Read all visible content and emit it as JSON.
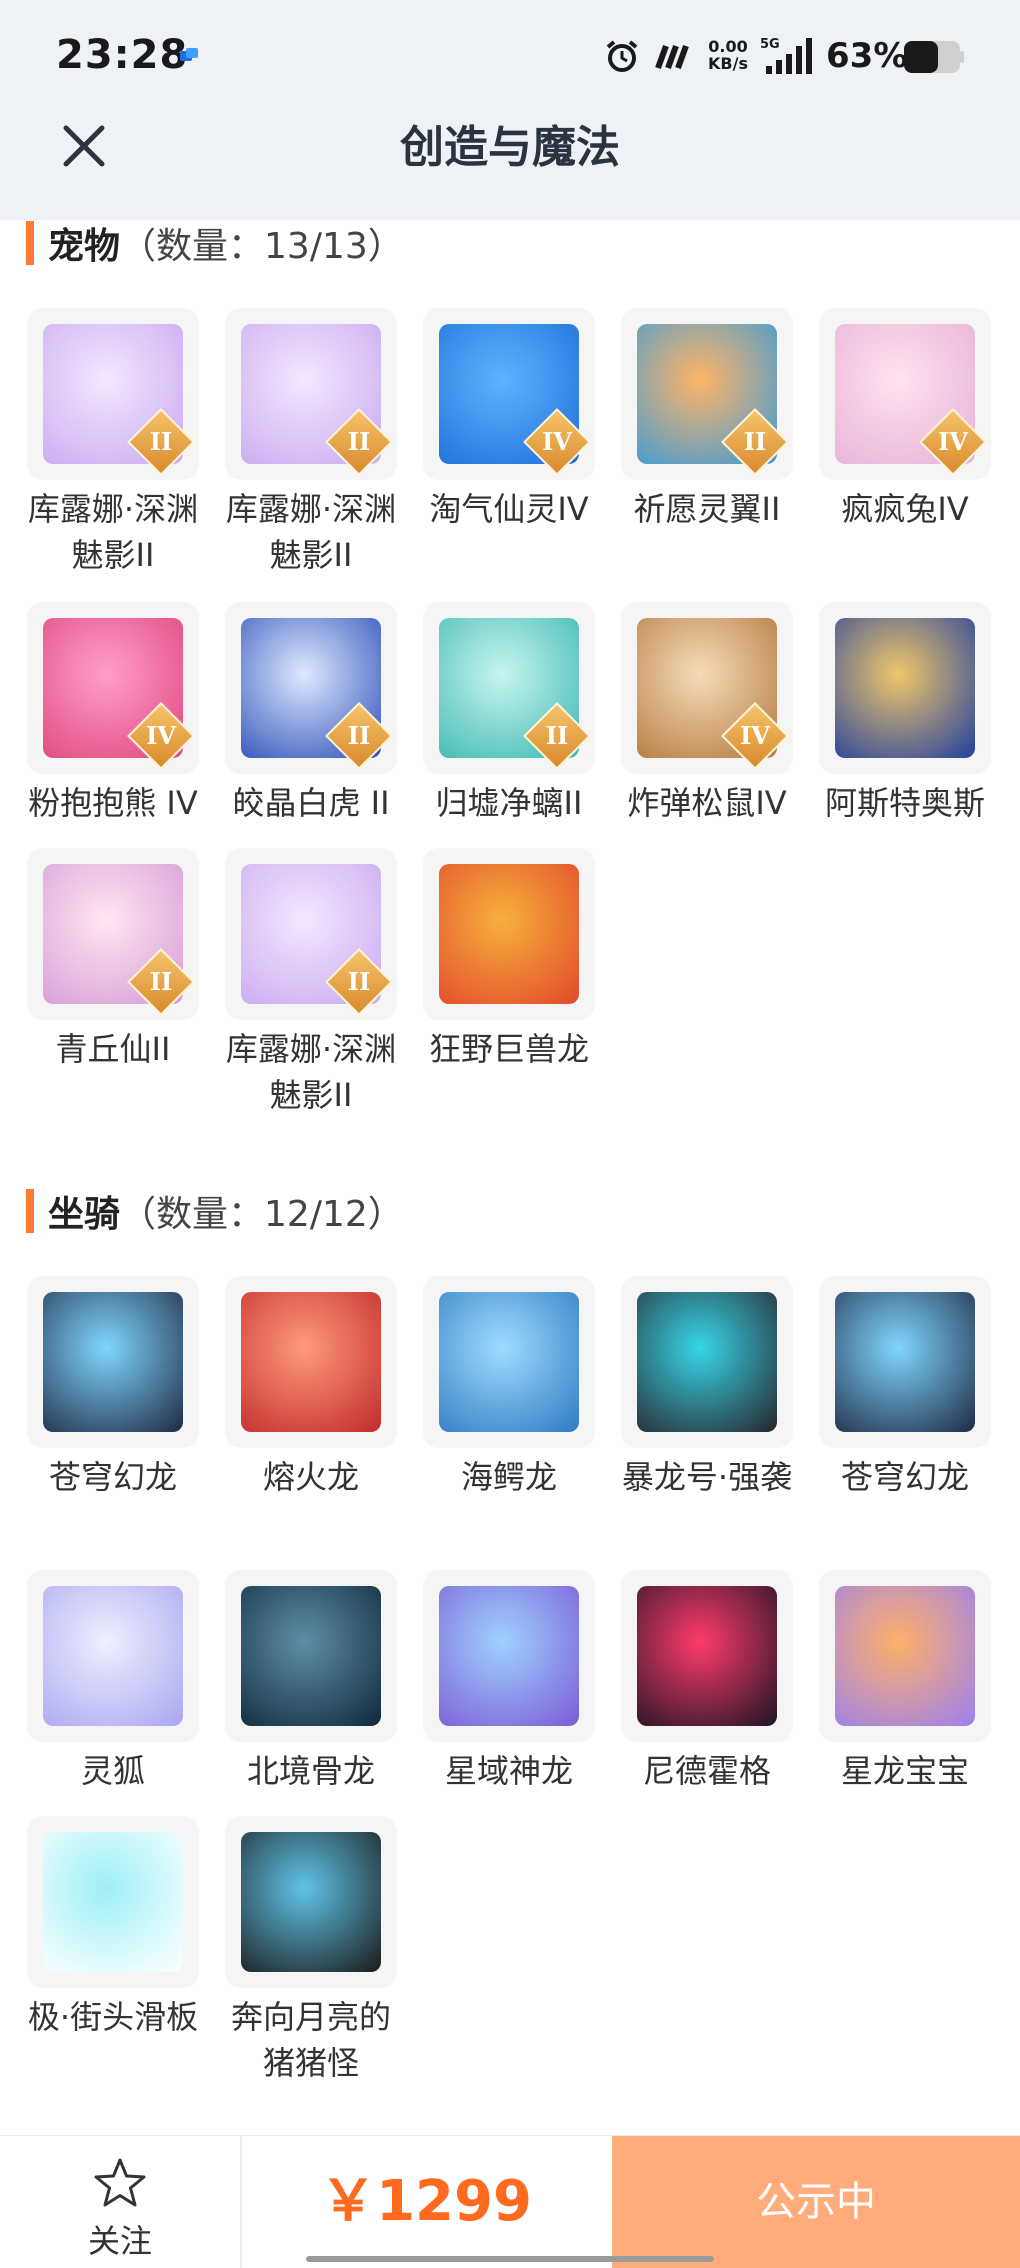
{
  "status": {
    "time": "23:28",
    "netspeed_value": "0.00",
    "netspeed_unit": "KB/s",
    "network": "5G",
    "battery": "63%"
  },
  "header": {
    "title": "创造与魔法",
    "close_icon": "close-icon"
  },
  "pets": {
    "name": "宠物",
    "count": "（数量：13/13）",
    "items": [
      {
        "label": "库露娜·深渊魅影II",
        "tier": "II",
        "c1": "#f3e8ff",
        "c2": "#c9a8f0"
      },
      {
        "label": "库露娜·深渊魅影II",
        "tier": "II",
        "c1": "#f3e8ff",
        "c2": "#c9a8f0"
      },
      {
        "label": "淘气仙灵IV",
        "tier": "IV",
        "c1": "#5fb3ff",
        "c2": "#1d6fd8"
      },
      {
        "label": "祈愿灵翼II",
        "tier": "II",
        "c1": "#ffb566",
        "c2": "#3a9ad9"
      },
      {
        "label": "疯疯兔IV",
        "tier": "IV",
        "c1": "#ffe3f0",
        "c2": "#e7b0d6"
      },
      {
        "label": "粉抱抱熊 IV",
        "tier": "IV",
        "c1": "#ff9ec8",
        "c2": "#e0467f"
      },
      {
        "label": "皎晶白虎 II",
        "tier": "II",
        "c1": "#dfe9ff",
        "c2": "#2b4fb8"
      },
      {
        "label": "归墟净螭II",
        "tier": "II",
        "c1": "#c8f5f0",
        "c2": "#3bb8b0"
      },
      {
        "label": "炸弹松鼠IV",
        "tier": "IV",
        "c1": "#f6dcb8",
        "c2": "#b4783e"
      },
      {
        "label": "阿斯特奥斯",
        "tier": "",
        "c1": "#f0c76a",
        "c2": "#203f9e"
      },
      {
        "label": "青丘仙II",
        "tier": "II",
        "c1": "#ffe7f2",
        "c2": "#d79ad6"
      },
      {
        "label": "库露娜·深渊魅影II",
        "tier": "II",
        "c1": "#f3e8ff",
        "c2": "#c9a8f0"
      },
      {
        "label": "狂野巨兽龙",
        "tier": "",
        "c1": "#f6b13b",
        "c2": "#e2482c"
      }
    ]
  },
  "mounts": {
    "name": "坐骑",
    "count": "（数量：12/12）",
    "items": [
      {
        "label": "苍穹幻龙",
        "c1": "#7fd6ff",
        "c2": "#1f2a44"
      },
      {
        "label": "熔火龙",
        "c1": "#ff9a7a",
        "c2": "#c12a2a"
      },
      {
        "label": "海鳄龙",
        "c1": "#9fdcff",
        "c2": "#2d7bc2"
      },
      {
        "label": "暴龙号·强袭",
        "c1": "#37d6e8",
        "c2": "#26242c"
      },
      {
        "label": "苍穹幻龙",
        "c1": "#7fd6ff",
        "c2": "#1f2a44"
      },
      {
        "label": "灵狐",
        "c1": "#eef0ff",
        "c2": "#a9a6f0"
      },
      {
        "label": "北境骨龙",
        "c1": "#5d8fa8",
        "c2": "#10283a"
      },
      {
        "label": "星域神龙",
        "c1": "#9fd2ff",
        "c2": "#7b5bd6"
      },
      {
        "label": "尼德霍格",
        "c1": "#ff3b6b",
        "c2": "#1d1424"
      },
      {
        "label": "星龙宝宝",
        "c1": "#ffb06a",
        "c2": "#9a7ff0"
      },
      {
        "label": "极·街头滑板",
        "c1": "#9ef0f6",
        "c2": "#ffffff"
      },
      {
        "label": "奔向月亮的猪猪怪",
        "c1": "#5ec4e8",
        "c2": "#1a1a1a"
      }
    ]
  },
  "bottom": {
    "follow_label": "关注",
    "price": "￥1299",
    "cta_label": "公示中"
  },
  "colors": {
    "accent": "#ff7a33",
    "price": "#ff6a1f",
    "cta": "#ffab7a"
  }
}
